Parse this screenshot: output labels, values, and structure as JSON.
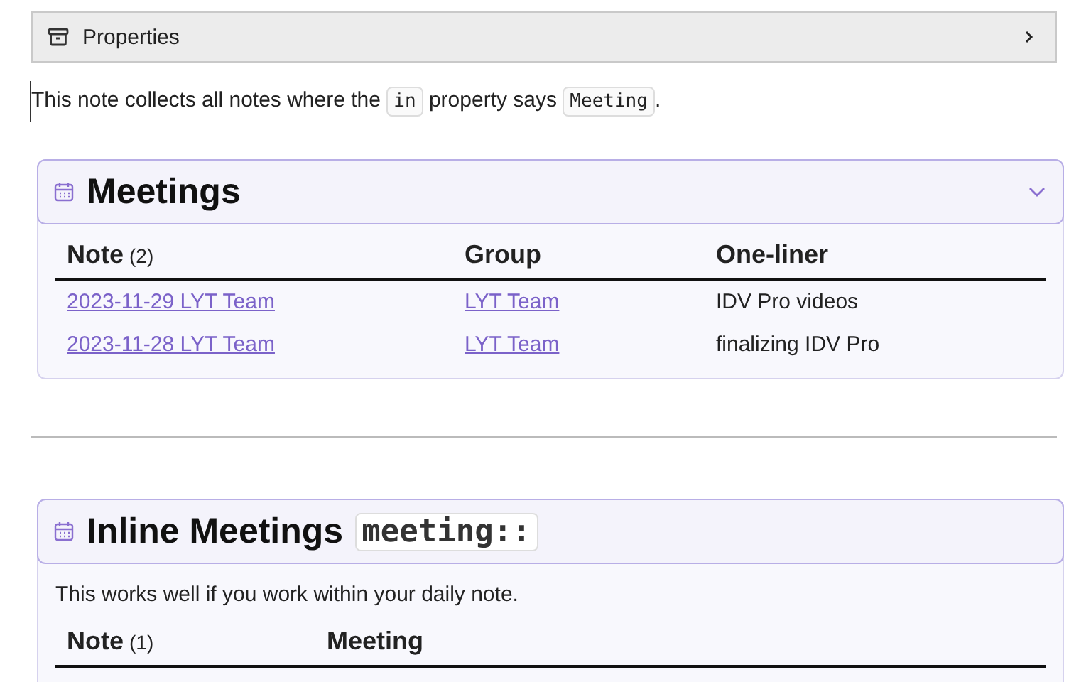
{
  "properties": {
    "label": "Properties",
    "expanded": false
  },
  "intro": [
    {
      "kind": "text",
      "text": "This note collects all notes where the "
    },
    {
      "kind": "code",
      "text": "in"
    },
    {
      "kind": "text",
      "text": " property says "
    },
    {
      "kind": "code",
      "text": "Meeting"
    },
    {
      "kind": "text",
      "text": "."
    }
  ],
  "callouts": [
    {
      "title": [
        {
          "kind": "text",
          "text": "Meetings"
        }
      ],
      "foldable": true,
      "columns": [
        {
          "label": "Note",
          "count": "(2)"
        },
        {
          "label": "Group"
        },
        {
          "label": "One-liner"
        }
      ],
      "rows": [
        [
          {
            "kind": "link",
            "text": "2023-11-29 LYT Team"
          },
          {
            "kind": "link",
            "text": "LYT Team"
          },
          {
            "kind": "text",
            "text": "IDV Pro videos"
          }
        ],
        [
          {
            "kind": "link",
            "text": "2023-11-28 LYT Team"
          },
          {
            "kind": "link",
            "text": "LYT Team"
          },
          {
            "kind": "text",
            "text": "finalizing IDV Pro"
          }
        ]
      ]
    },
    {
      "title": [
        {
          "kind": "text",
          "text": "Inline Meetings"
        },
        {
          "kind": "code",
          "text": "meeting::"
        }
      ],
      "foldable": false,
      "description": "This works well if you work within your daily note.",
      "columns": [
        {
          "label": "Note",
          "count": "(1)"
        },
        {
          "label": "Meeting"
        }
      ]
    }
  ]
}
